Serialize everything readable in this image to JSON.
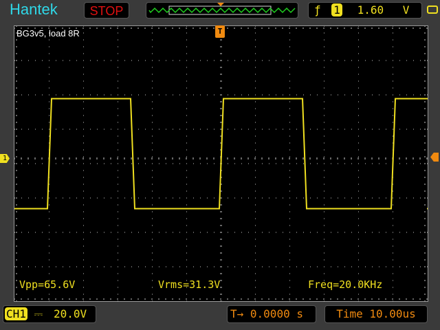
{
  "header": {
    "brand": "Hantek",
    "run_state": "STOP",
    "trigger_channel": "1",
    "trigger_level": "1.60",
    "trigger_unit": "V"
  },
  "screen": {
    "label": "BG3v5, load 8R",
    "trigger_marker": "T",
    "channel_marker": "1"
  },
  "measurements": {
    "vpp": "Vpp=65.6V",
    "vrms": "Vrms=31.3V",
    "freq": "Freq=20.0KHz"
  },
  "footer": {
    "channel": "CH1",
    "coupling_icon": "dc-coupling-icon",
    "volts_div": "20.0V",
    "trigger_pos": "0.0000 s",
    "timebase": "Time 10.00us"
  },
  "colors": {
    "trace": "#f0e020",
    "trigger": "#f08a10",
    "brand": "#2fd8e8"
  },
  "waveform": {
    "type": "square",
    "frequency_khz": 20.0,
    "high_div": 1.75,
    "low_div": -1.45,
    "first_rise_div": 1.0
  }
}
